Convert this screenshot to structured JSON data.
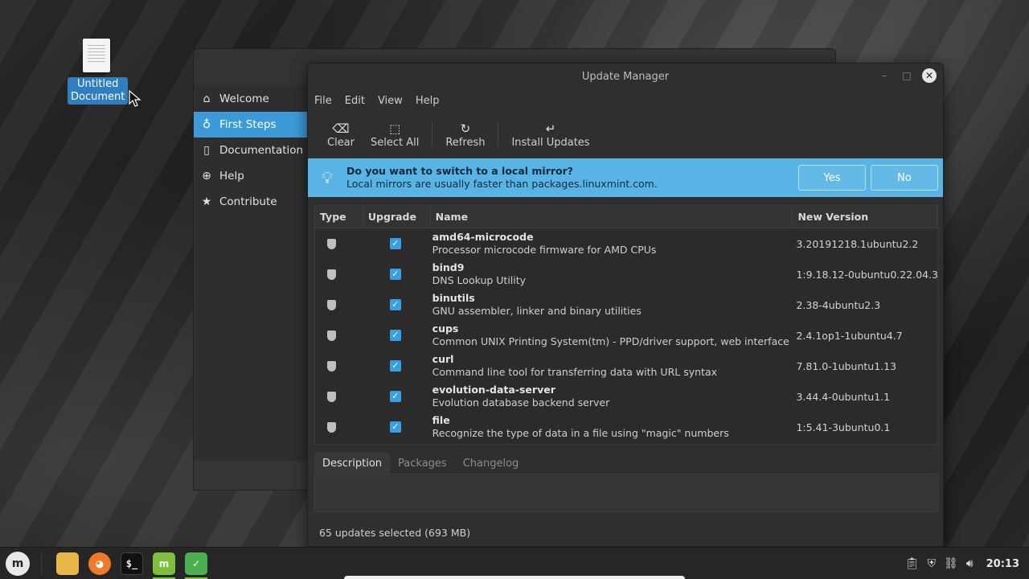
{
  "desktop": {
    "icon_label_line1": "Untitled",
    "icon_label_line2": "Document"
  },
  "welcome_window": {
    "sidebar": [
      {
        "label": "Welcome",
        "icon": "home-icon"
      },
      {
        "label": "First Steps",
        "icon": "lightbulb-icon",
        "active": true
      },
      {
        "label": "Documentation",
        "icon": "book-icon"
      },
      {
        "label": "Help",
        "icon": "lifebuoy-icon"
      },
      {
        "label": "Contribute",
        "icon": "star-icon"
      }
    ]
  },
  "update_manager": {
    "title": "Update Manager",
    "menu": [
      "File",
      "Edit",
      "View",
      "Help"
    ],
    "toolbar": {
      "clear": "Clear",
      "select_all": "Select All",
      "refresh": "Refresh",
      "install": "Install Updates"
    },
    "infobar": {
      "title": "Do you want to switch to a local mirror?",
      "subtitle": "Local mirrors are usually faster than packages.linuxmint.com.",
      "yes": "Yes",
      "no": "No"
    },
    "columns": {
      "type": "Type",
      "upgrade": "Upgrade",
      "name": "Name",
      "version": "New Version"
    },
    "packages": [
      {
        "name": "amd64-microcode",
        "desc": "Processor microcode firmware for AMD CPUs",
        "version": "3.20191218.1ubuntu2.2"
      },
      {
        "name": "bind9",
        "desc": "DNS Lookup Utility",
        "version": "1:9.18.12-0ubuntu0.22.04.3"
      },
      {
        "name": "binutils",
        "desc": "GNU assembler, linker and binary utilities",
        "version": "2.38-4ubuntu2.3"
      },
      {
        "name": "cups",
        "desc": "Common UNIX Printing System(tm) - PPD/driver support, web interface",
        "version": "2.4.1op1-1ubuntu4.7"
      },
      {
        "name": "curl",
        "desc": "Command line tool for transferring data with URL syntax",
        "version": "7.81.0-1ubuntu1.13"
      },
      {
        "name": "evolution-data-server",
        "desc": "Evolution database backend server",
        "version": "3.44.4-0ubuntu1.1"
      },
      {
        "name": "file",
        "desc": "Recognize the type of data in a file using \"magic\" numbers",
        "version": "1:5.41-3ubuntu0.1"
      }
    ],
    "tabs": [
      "Description",
      "Packages",
      "Changelog"
    ],
    "status": "65 updates selected (693 MB)"
  },
  "taskbar": {
    "clock": "20:13"
  }
}
